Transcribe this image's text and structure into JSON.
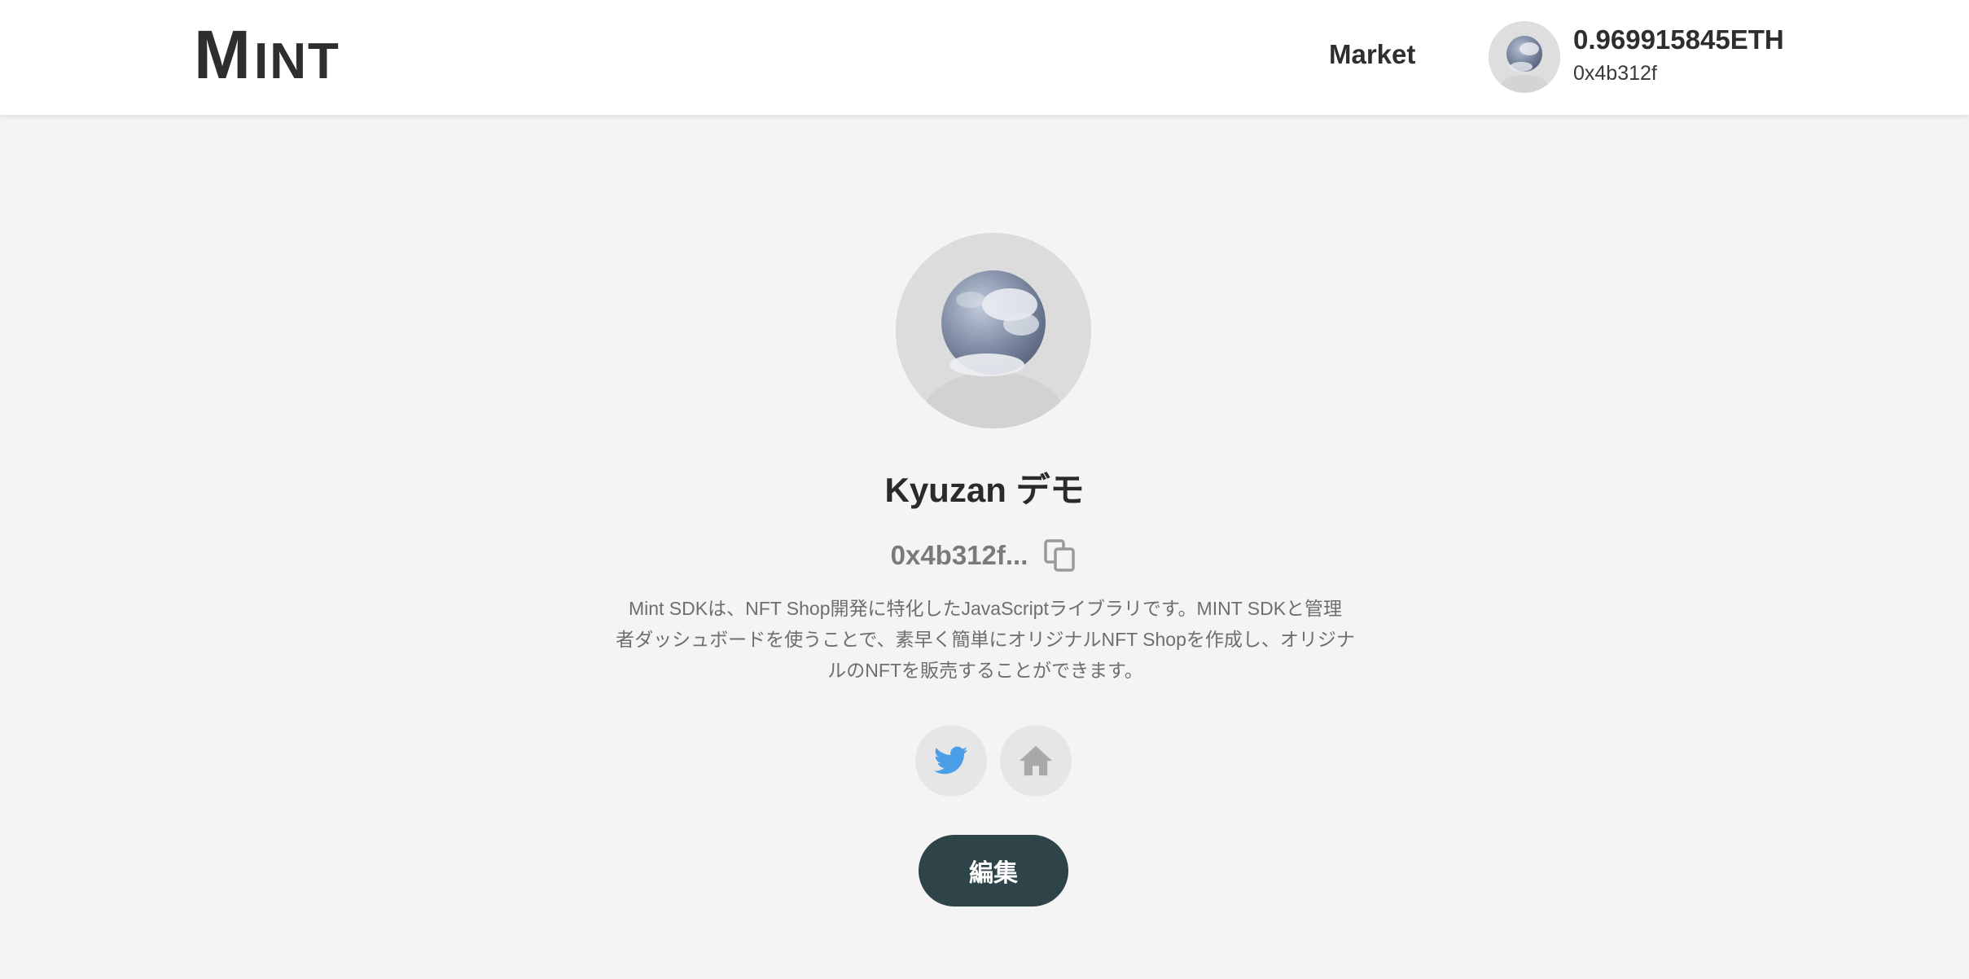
{
  "header": {
    "logo_big": "M",
    "logo_small": "INT",
    "nav_market": "Market",
    "wallet_balance": "0.969915845ETH",
    "wallet_address": "0x4b312f"
  },
  "profile": {
    "name": "Kyuzan デモ",
    "address_short": "0x4b312f...",
    "bio_line1": "Mint SDKは、NFT Shop開発に特化したJavaScriptライブラリです。MINT SDKと管理",
    "bio_line2": "者ダッシュボードを使うことで、素早く簡単にオリジナルNFT Shopを作成し、オリジナ",
    "bio_line3": "ルのNFTを販売することができます。",
    "edit_label": "編集"
  },
  "icons": {
    "copy": "copy-icon",
    "twitter": "twitter-icon",
    "home": "home-icon",
    "avatar": "planet-avatar"
  },
  "colors": {
    "header_bg": "#ffffff",
    "page_bg": "#f4f4f4",
    "edit_button": "#2e4448",
    "twitter_blue": "#4a9fe8"
  }
}
